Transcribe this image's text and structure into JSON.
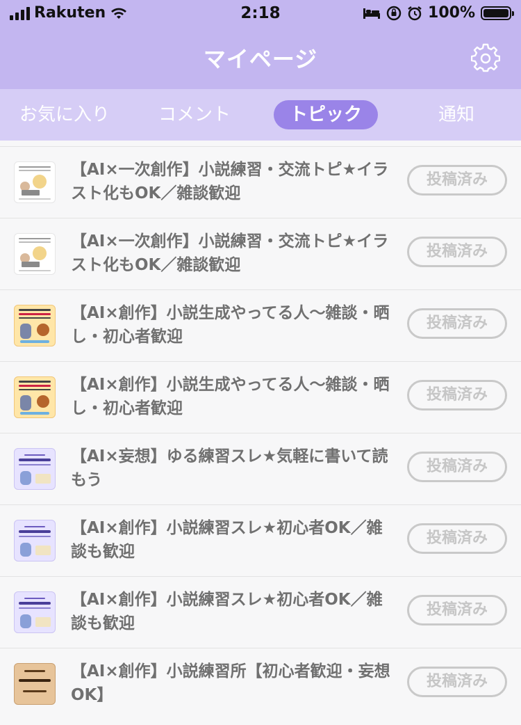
{
  "status_bar": {
    "carrier": "Rakuten",
    "time": "2:18",
    "battery": "100%"
  },
  "header": {
    "title": "マイページ",
    "settings_icon": "gear-icon"
  },
  "tabs": [
    {
      "label": "お気に入り",
      "active": false
    },
    {
      "label": "コメント",
      "active": false
    },
    {
      "label": "トピック",
      "active": true
    },
    {
      "label": "通知",
      "active": false
    }
  ],
  "topics": [
    {
      "title": "【AI×一次創作】小説練習・交流トピ★イラスト化もOK／雑談歓迎",
      "button": "投稿済み"
    },
    {
      "title": "【AI×一次創作】小説練習・交流トピ★イラスト化もOK／雑談歓迎",
      "button": "投稿済み"
    },
    {
      "title": "【AI×創作】小説生成やってる人〜雑談・晒し・初心者歓迎",
      "button": "投稿済み"
    },
    {
      "title": "【AI×創作】小説生成やってる人〜雑談・晒し・初心者歓迎",
      "button": "投稿済み"
    },
    {
      "title": "【AI×妄想】ゆる練習スレ★気軽に書いて読もう",
      "button": "投稿済み"
    },
    {
      "title": "【AI×創作】小説練習スレ★初心者OK／雑談も歓迎",
      "button": "投稿済み"
    },
    {
      "title": "【AI×創作】小説練習スレ★初心者OK／雑談も歓迎",
      "button": "投稿済み"
    },
    {
      "title": "【AI×創作】小説練習所【初心者歓迎・妄想OK】",
      "button": "投稿済み"
    }
  ],
  "colors": {
    "header": "#c3b6f0",
    "tab_bar": "#d6cdf6",
    "active_tab": "#9a84e8"
  }
}
